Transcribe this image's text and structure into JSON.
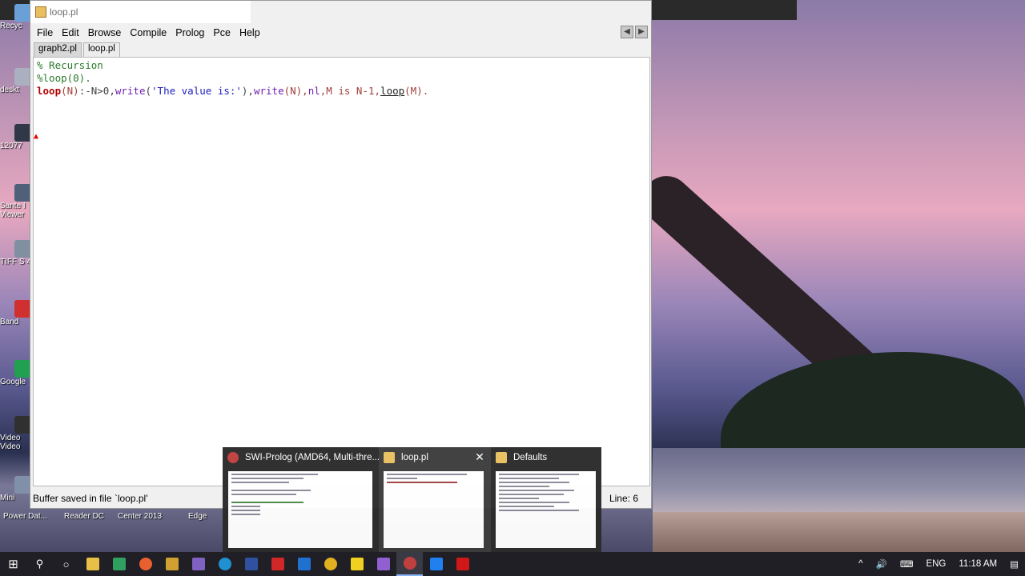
{
  "window": {
    "title": "loop.pl"
  },
  "menu": [
    "File",
    "Edit",
    "Browse",
    "Compile",
    "Prolog",
    "Pce",
    "Help"
  ],
  "tabs": [
    {
      "label": "graph2.pl",
      "active": false
    },
    {
      "label": "loop.pl",
      "active": true
    }
  ],
  "code": {
    "line1": "% Recursion",
    "line2": "%loop(0).",
    "line3": {
      "head": "loop",
      "args": "(N)",
      "neck": ":-N>0,",
      "write1": "write",
      "arg1a": "(",
      "str": "'The value is:'",
      "arg1b": "),",
      "write2": "write",
      "arg2": "(N),",
      "nl": "nl",
      "rest": ",M is N-1,",
      "call": "loop",
      "tail": "(M)."
    }
  },
  "status": {
    "message": "Buffer saved in file `loop.pl'",
    "line": "Line: 6"
  },
  "desktop_icons": [
    "Recyc",
    "deskt",
    "12077",
    "Sante I Viewer",
    "TIFF S 4",
    "Band",
    "Google",
    "Video Video",
    "Mini",
    "Power Dat..."
  ],
  "desktop_labels_bottom": [
    "Reader DC",
    "Center 2013",
    "Edge"
  ],
  "preview": {
    "cards": [
      {
        "title": "SWI-Prolog (AMD64, Multi-thre...",
        "color": "#c04040"
      },
      {
        "title": "loop.pl",
        "color": "#e8c060"
      },
      {
        "title": "Defaults",
        "color": "#e8c060"
      }
    ],
    "close": "✕"
  },
  "taskbar": {
    "start_icon": "windows-logo",
    "time": "11:18 AM",
    "language": "ENG",
    "tray_up": "^"
  }
}
